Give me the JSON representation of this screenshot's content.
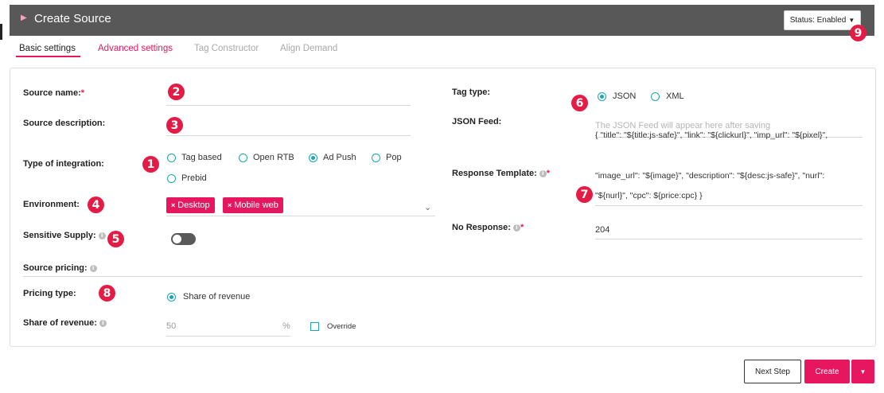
{
  "header": {
    "title": "Create Source",
    "status_label": "Status: Enabled"
  },
  "tabs": [
    {
      "label": "Basic settings"
    },
    {
      "label": "Advanced settings"
    },
    {
      "label": "Tag Constructor"
    },
    {
      "label": "Align Demand"
    }
  ],
  "badges": [
    "1",
    "2",
    "3",
    "4",
    "5",
    "6",
    "7",
    "8",
    "9"
  ],
  "form": {
    "source_name": {
      "label": "Source name:",
      "required": "*",
      "value": ""
    },
    "source_description": {
      "label": "Source description:",
      "value": ""
    },
    "integration": {
      "label": "Type of integration:",
      "options": [
        "Tag based",
        "Open RTB",
        "Ad Push",
        "Pop",
        "Prebid"
      ],
      "selected": "Ad Push"
    },
    "environment": {
      "label": "Environment:",
      "chips": [
        "Desktop",
        "Mobile web"
      ],
      "chip_remove_glyph": "×"
    },
    "sensitive_supply": {
      "label": "Sensitive Supply:",
      "value": false
    },
    "source_pricing": {
      "label": "Source pricing:"
    },
    "pricing_type": {
      "label": "Pricing type:",
      "option": "Share of revenue"
    },
    "share_of_revenue": {
      "label": "Share of revenue:",
      "value": "50",
      "unit": "%",
      "override_label": "Override"
    },
    "tag_type": {
      "label": "Tag type:",
      "options": [
        "JSON",
        "XML"
      ],
      "selected": "JSON"
    },
    "json_feed": {
      "label": "JSON Feed:",
      "placeholder": "The JSON Feed will appear here after saving"
    },
    "response_template": {
      "label": "Response Template:",
      "required": "*",
      "lines": [
        "{ \"title\": \"${title:js-safe}\", \"link\": \"${clickurl}\", \"imp_url\": \"${pixel}\",",
        "\"image_url\": \"${image}\", \"description\": \"${desc:js-safe}\", \"nurl\":",
        "\"${nurl}\", \"cpc\": ${price:cpc} }"
      ]
    },
    "no_response": {
      "label": "No Response:",
      "required": "*",
      "value": "204"
    }
  },
  "footer": {
    "next_label": "Next Step",
    "create_label": "Create"
  },
  "colors": {
    "accent": "#e6175e",
    "badge": "#e31b45",
    "radio": "#1aa5b8",
    "header_bg": "#585858"
  },
  "icons": {
    "info": "info-icon",
    "dropdown": "caret-down-icon",
    "chevron": "chevron-down-icon"
  }
}
